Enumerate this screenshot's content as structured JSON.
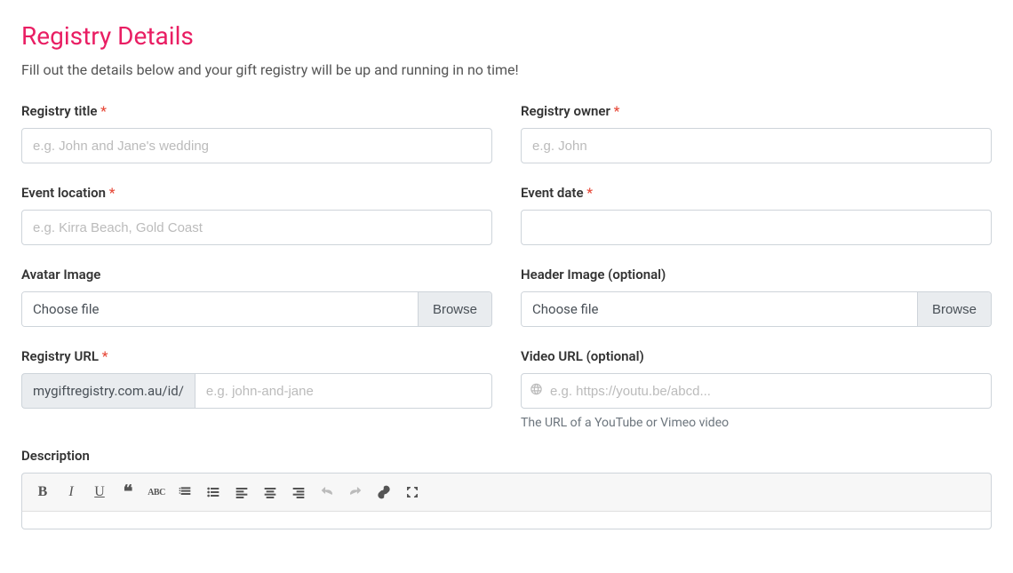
{
  "title": "Registry Details",
  "subtitle": "Fill out the details below and your gift registry will be up and running in no time!",
  "fields": {
    "registry_title": {
      "label": "Registry title",
      "placeholder": "e.g. John and Jane's wedding",
      "required": true
    },
    "registry_owner": {
      "label": "Registry owner",
      "placeholder": "e.g. John",
      "required": true
    },
    "event_location": {
      "label": "Event location",
      "placeholder": "e.g. Kirra Beach, Gold Coast",
      "required": true
    },
    "event_date": {
      "label": "Event date",
      "placeholder": "",
      "required": true
    },
    "avatar_image": {
      "label": "Avatar Image",
      "choose": "Choose file",
      "button": "Browse"
    },
    "header_image": {
      "label": "Header Image (optional)",
      "choose": "Choose file",
      "button": "Browse"
    },
    "registry_url": {
      "label": "Registry URL",
      "prefix": "mygiftregistry.com.au/id/",
      "placeholder": "e.g. john-and-jane",
      "required": true
    },
    "video_url": {
      "label": "Video URL (optional)",
      "placeholder": "e.g. https://youtu.be/abcd...",
      "help": "The URL of a YouTube or Vimeo video"
    },
    "description": {
      "label": "Description"
    }
  },
  "required_marker": "*"
}
